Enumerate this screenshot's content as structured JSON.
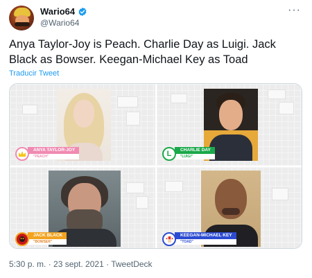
{
  "tweet": {
    "display_name": "Wario64",
    "handle": "@Wario64",
    "more_icon": "more-dots-icon",
    "text": "Anya Taylor-Joy is Peach. Charlie Day as Luigi. Jack Black as Bowser. Keegan-Michael Key as Toad",
    "translate_label": "Traducir Tweet",
    "timestamp": "5:30 p. m. · 23 sept. 2021 · TweetDeck"
  },
  "media": {
    "tiles": [
      {
        "actor": "ANYA TAYLOR-JOY",
        "character": "\"PEACH\"",
        "emblem": "crown-icon",
        "color": "#f08ab1",
        "char_color": "#f08ab1"
      },
      {
        "actor": "CHARLIE DAY",
        "character": "\"LUIGI\"",
        "emblem": "L",
        "color": "#1aa84a",
        "char_color": "#1aa84a"
      },
      {
        "actor": "JACK BLACK",
        "character": "\"BOWSER\"",
        "emblem": "bowser-emblem-icon",
        "color": "#f2a320",
        "char_color": "#e2852a"
      },
      {
        "actor": "KEEGAN-MICHAEL KEY",
        "character": "\"TOAD\"",
        "emblem": "toad-emblem-icon",
        "color": "#2b4bd1",
        "char_color": "#2b4bd1"
      }
    ]
  },
  "colors": {
    "accent": "#1d9bf0",
    "text": "#0f1419",
    "secondary": "#536471"
  }
}
